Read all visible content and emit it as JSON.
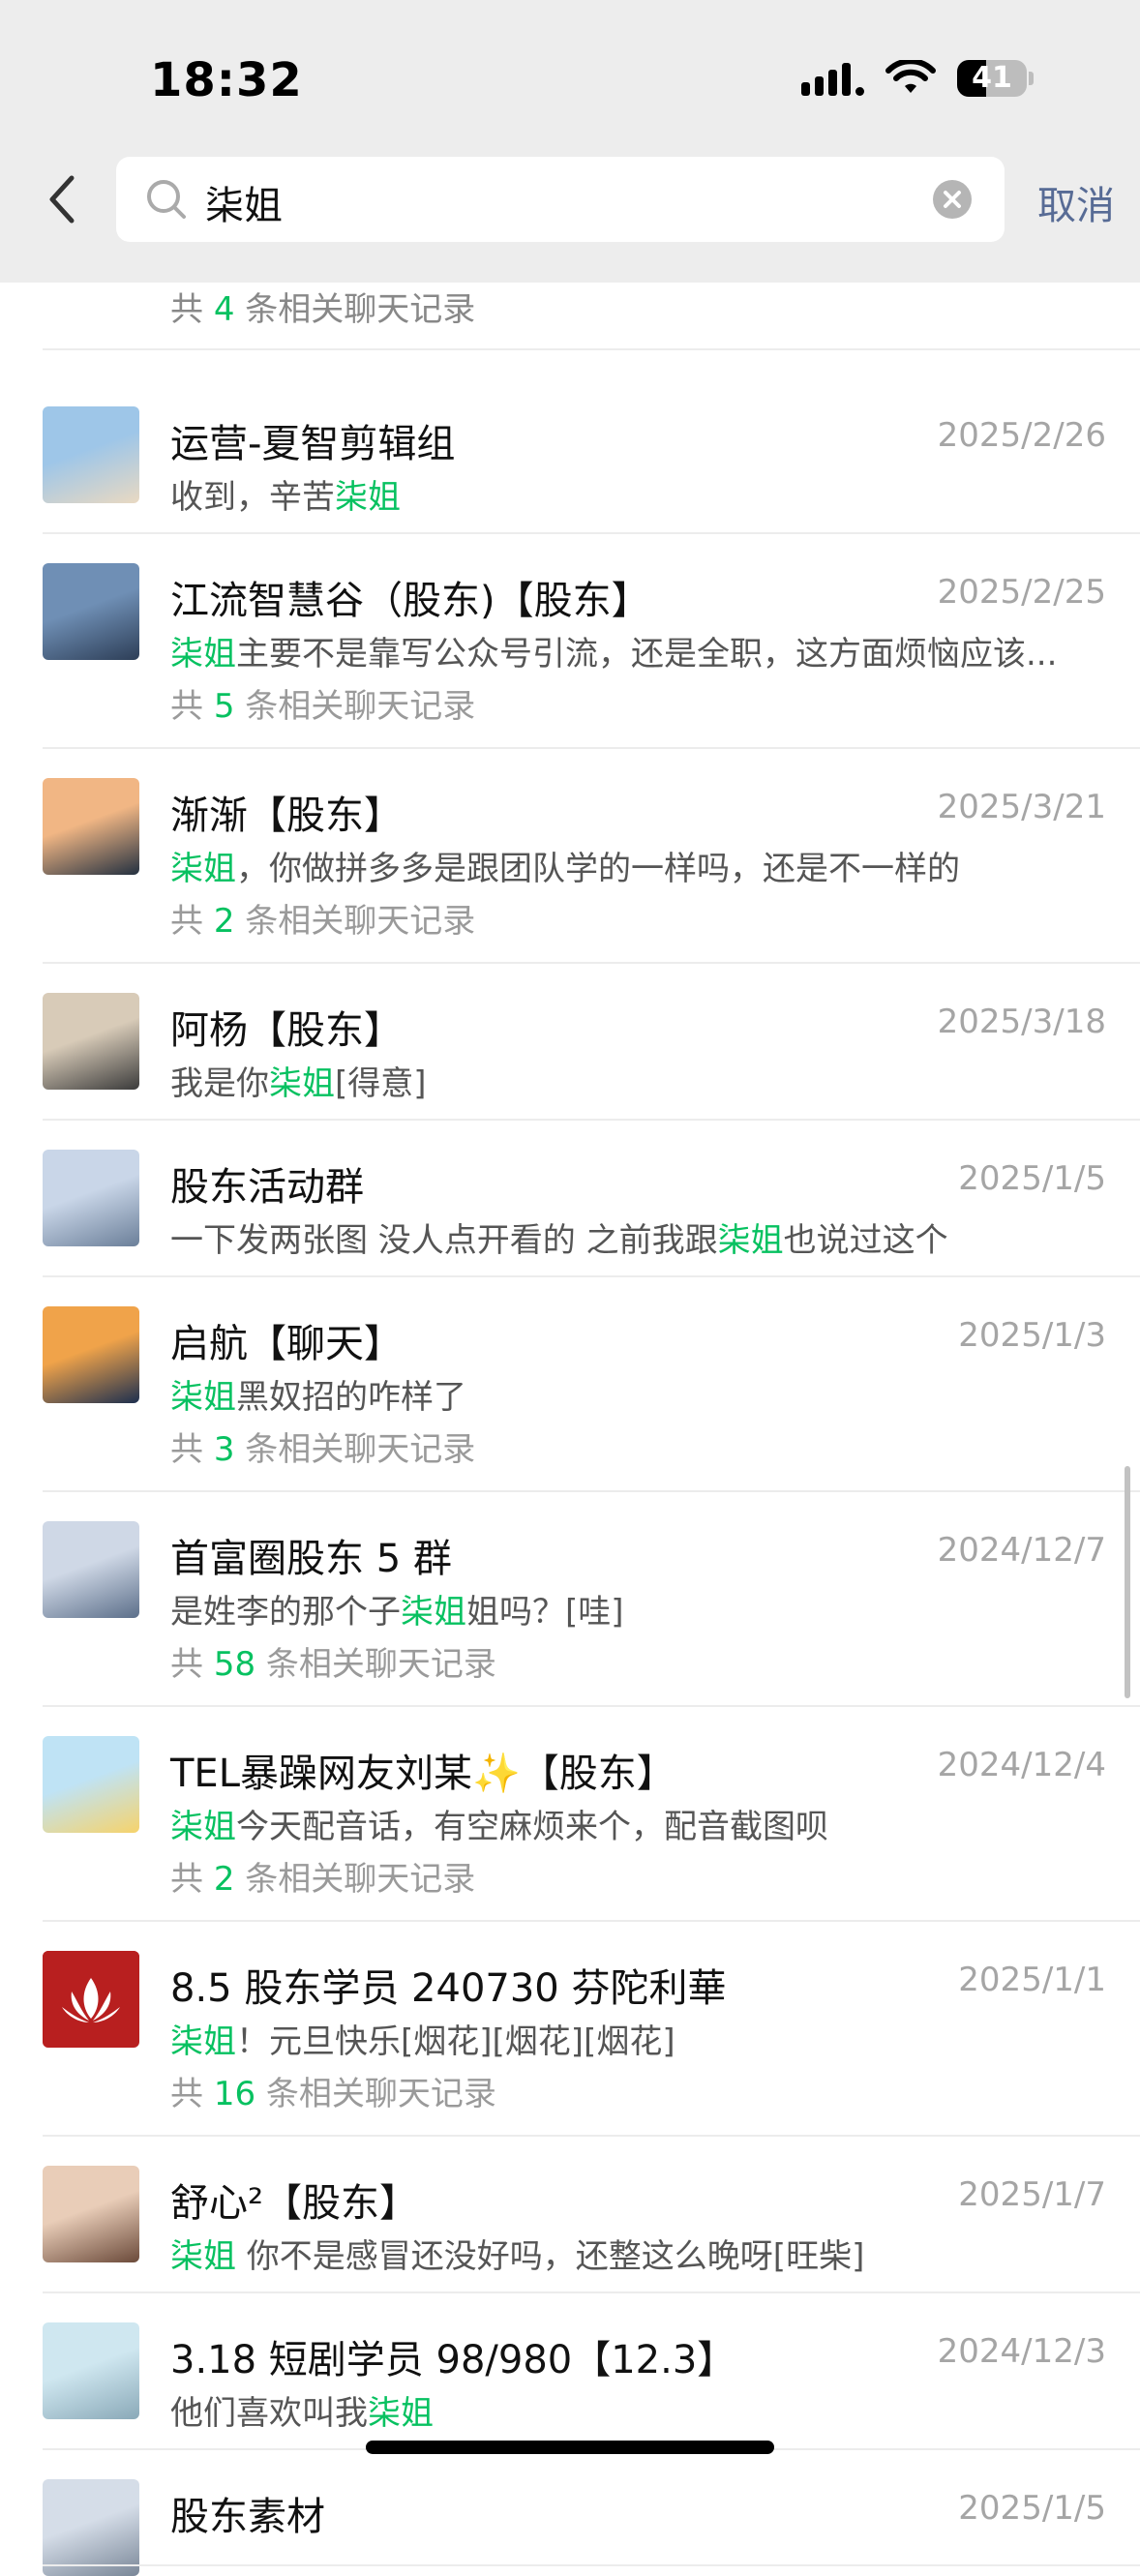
{
  "status_bar": {
    "time": "18:32",
    "battery": "41"
  },
  "search": {
    "query": "柒姐",
    "cancel_label": "取消"
  },
  "partial_top": {
    "prefix": "共 ",
    "count": "4",
    "suffix": " 条相关聊天记录"
  },
  "keyword": "柒姐",
  "results": [
    {
      "title": "运营-夏智剪辑组",
      "date": "2025/2/26",
      "snippet_before": "收到，辛苦",
      "snippet_after": "",
      "count": null
    },
    {
      "title": "江流智慧谷（股东)【股东】",
      "date": "2025/2/25",
      "snippet_before": "",
      "snippet_after": "主要不是靠写公众号引流，还是全职，这方面烦恼应该...",
      "count": "5"
    },
    {
      "title": "渐渐【股东】",
      "date": "2025/3/21",
      "snippet_before": "",
      "snippet_after": "，你做拼多多是跟团队学的一样吗，还是不一样的",
      "count": "2"
    },
    {
      "title": "阿杨【股东】",
      "date": "2025/3/18",
      "snippet_before": "我是你",
      "snippet_after": "[得意]",
      "count": null
    },
    {
      "title": "股东活动群",
      "date": "2025/1/5",
      "snippet_before": "一下发两张图 没人点开看的 之前我跟",
      "snippet_after": "也说过这个",
      "count": null
    },
    {
      "title": "启航【聊天】",
      "date": "2025/1/3",
      "snippet_before": "",
      "snippet_after": "黑奴招的咋样了",
      "count": "3"
    },
    {
      "title": "首富圈股东 5 群",
      "date": "2024/12/7",
      "snippet_before": "是姓李的那个子",
      "snippet_after": "姐吗？[哇]",
      "count": "58"
    },
    {
      "title": "TEL暴躁网友刘某✨【股东】",
      "date": "2024/12/4",
      "snippet_before": "",
      "snippet_after": "今天配音话，有空麻烦来个，配音截图呗",
      "count": "2"
    },
    {
      "title": "8.5 股东学员 240730 芬陀利華",
      "date": "2025/1/1",
      "snippet_before": "",
      "snippet_after": "！元旦快乐[烟花][烟花][烟花]",
      "count": "16"
    },
    {
      "title": "舒心²【股东】",
      "date": "2025/1/7",
      "snippet_before": "",
      "snippet_after": " 你不是感冒还没好吗，还整这么晚呀[旺柴]",
      "count": null
    },
    {
      "title": "3.18 短剧学员 98/980【12.3】",
      "date": "2024/12/3",
      "snippet_before": "他们喜欢叫我",
      "snippet_after": "",
      "count": null
    },
    {
      "title": "股东素材",
      "date": "2025/1/5",
      "snippet_before": "",
      "snippet_after": "",
      "count": null
    }
  ],
  "count_prefix": "共 ",
  "count_suffix": " 条相关聊天记录",
  "colors": {
    "keyword": "#07c160",
    "link": "#576b95",
    "date": "#a5a5a5"
  }
}
